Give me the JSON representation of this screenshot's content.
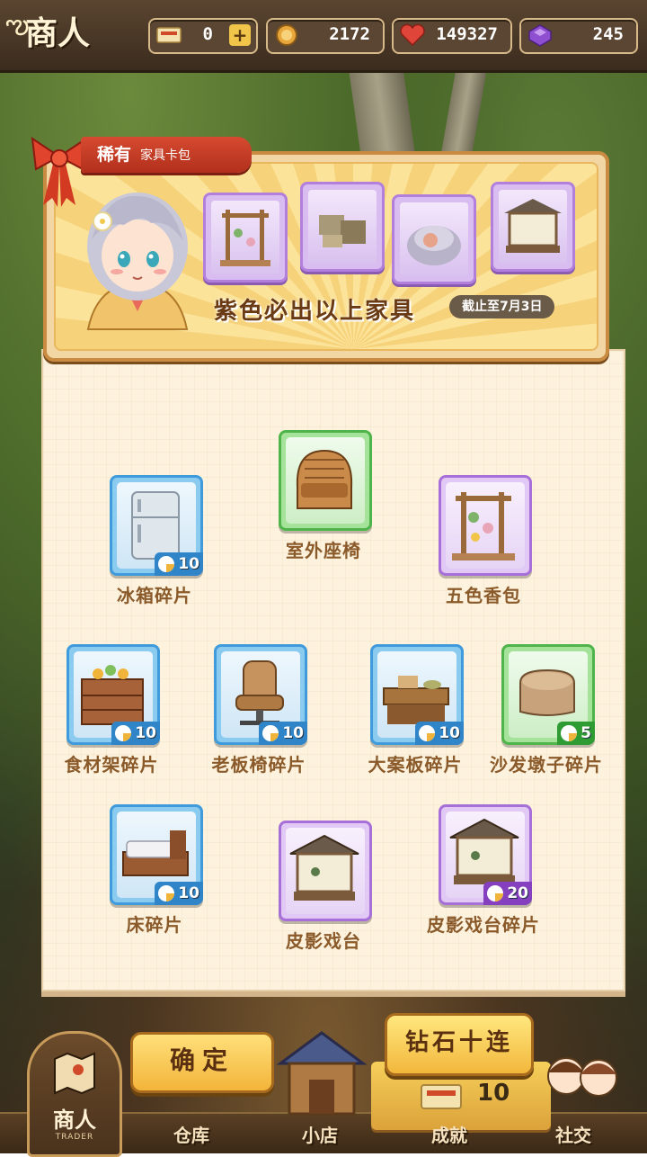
{
  "header": {
    "title": "商人",
    "ticket_count": "0",
    "plus_label": "+",
    "coins": "2172",
    "hearts": "149327",
    "gems": "245"
  },
  "banner": {
    "rarity": "稀有",
    "pack_name": "家具卡包",
    "slogan": "紫色必出以上家具",
    "deadline": "截止至7月3日"
  },
  "items": [
    {
      "label": "室外座椅",
      "rarity": "green",
      "count": ""
    },
    {
      "label": "冰箱碎片",
      "rarity": "blue",
      "count": "10"
    },
    {
      "label": "五色香包",
      "rarity": "purple",
      "count": ""
    },
    {
      "label": "食材架碎片",
      "rarity": "blue",
      "count": "10"
    },
    {
      "label": "老板椅碎片",
      "rarity": "blue",
      "count": "10"
    },
    {
      "label": "大案板碎片",
      "rarity": "blue",
      "count": "10"
    },
    {
      "label": "沙发墩子碎片",
      "rarity": "green",
      "count": "5"
    },
    {
      "label": "床碎片",
      "rarity": "blue",
      "count": "10"
    },
    {
      "label": "皮影戏台",
      "rarity": "purple",
      "count": ""
    },
    {
      "label": "皮影戏台碎片",
      "rarity": "purple",
      "count": "20"
    }
  ],
  "buttons": {
    "confirm": "确定",
    "ten_draw": "钻石十连",
    "ten_draw_cost": "10"
  },
  "nav": {
    "trader": "商人",
    "trader_sub": "TRADER",
    "warehouse": "仓库",
    "shop": "小店",
    "achievement": "成就",
    "social": "社交"
  },
  "colors": {
    "blue_tile": "#3f9bdb",
    "green_tile": "#4fb54a",
    "purple_tile": "#a76fd8",
    "label_text": "#8a5a2a"
  }
}
